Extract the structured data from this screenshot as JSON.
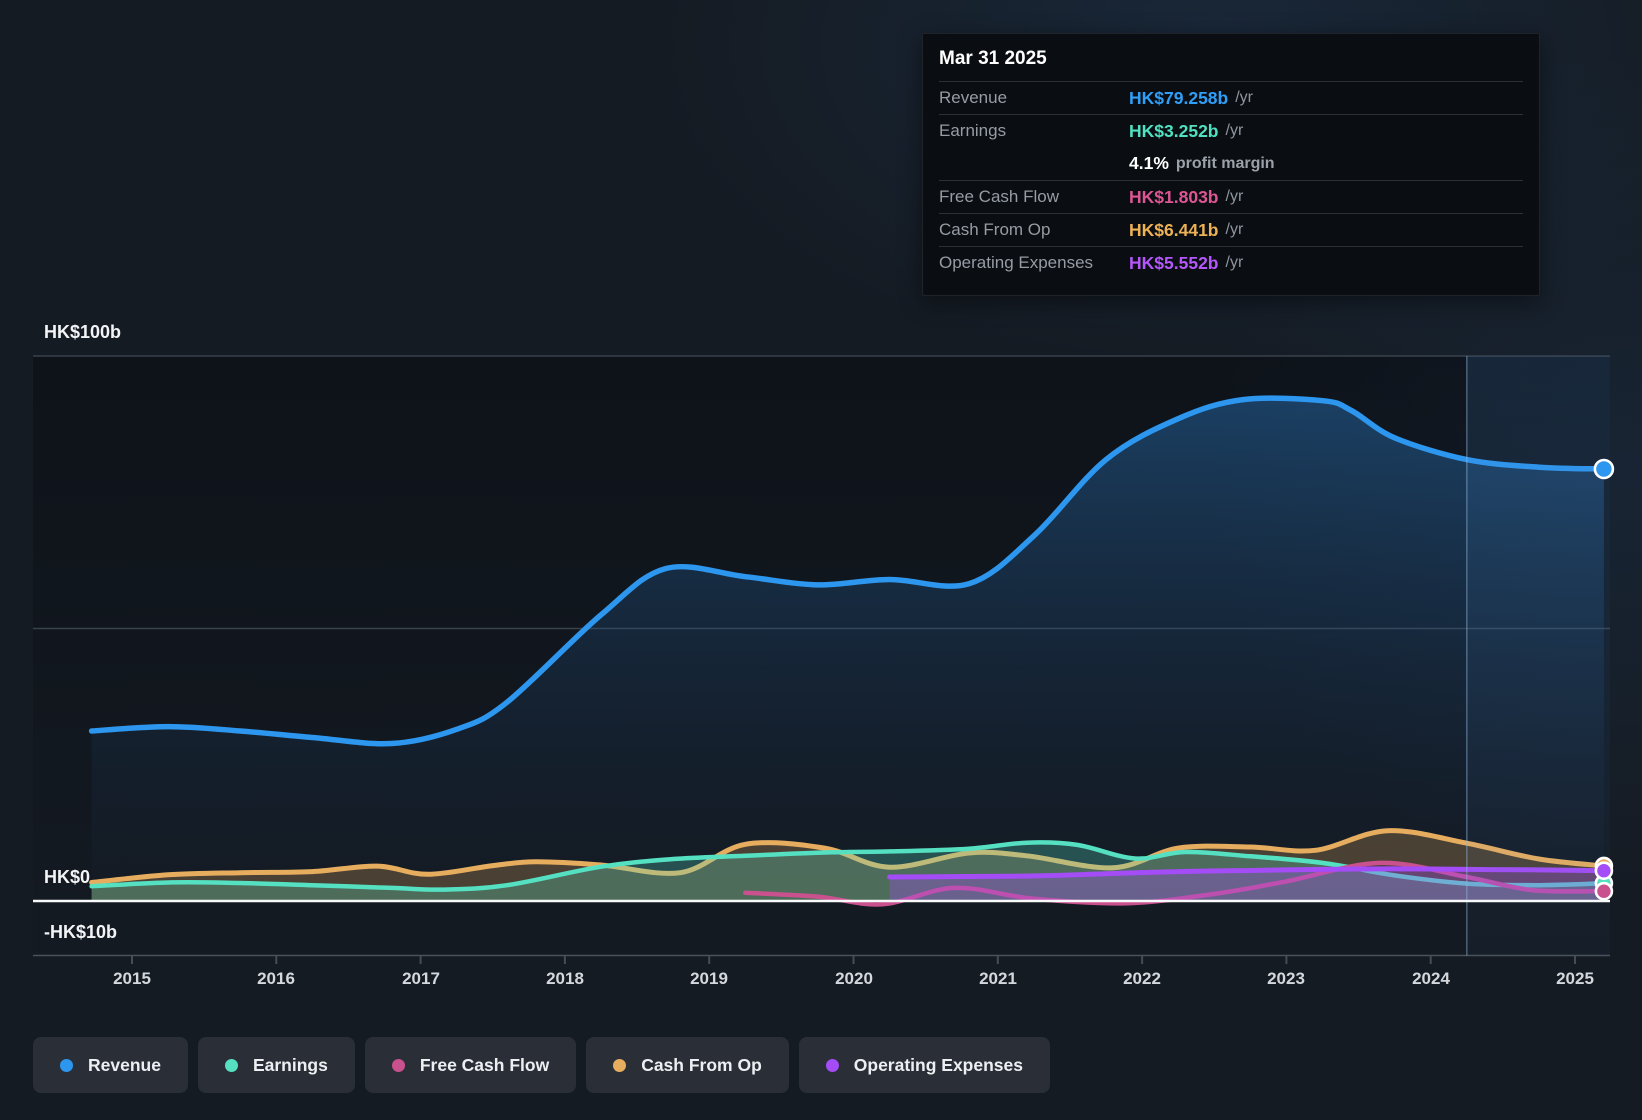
{
  "tooltip": {
    "date": "Mar 31 2025",
    "rows": [
      {
        "key": "revenue",
        "label": "Revenue",
        "value": "HK$79.258b",
        "suffix": "/yr",
        "color": "#2f9ff7",
        "divider_above": true,
        "suffix_strong": false
      },
      {
        "key": "earnings",
        "label": "Earnings",
        "value": "HK$3.252b",
        "suffix": "/yr",
        "color": "#50e2c0",
        "divider_above": true,
        "suffix_strong": false
      },
      {
        "key": "profit-margin",
        "label": "",
        "value": "4.1%",
        "suffix": "profit margin",
        "color": "#ffffff",
        "divider_above": false,
        "suffix_strong": true
      },
      {
        "key": "free-cash-flow",
        "label": "Free Cash Flow",
        "value": "HK$1.803b",
        "suffix": "/yr",
        "color": "#dd5693",
        "divider_above": true,
        "suffix_strong": false
      },
      {
        "key": "cash-from-op",
        "label": "Cash From Op",
        "value": "HK$6.441b",
        "suffix": "/yr",
        "color": "#edb256",
        "divider_above": true,
        "suffix_strong": false
      },
      {
        "key": "operating-expenses",
        "label": "Operating Expenses",
        "value": "HK$5.552b",
        "suffix": "/yr",
        "color": "#b557fa",
        "divider_above": true,
        "suffix_strong": false
      }
    ]
  },
  "y_axis": {
    "labels": [
      {
        "text": "HK$100b",
        "value": 100
      },
      {
        "text": "HK$0",
        "value": 0
      },
      {
        "text": "-HK$10b",
        "value": -10
      }
    ]
  },
  "x_axis": {
    "years": [
      2015,
      2016,
      2017,
      2018,
      2019,
      2020,
      2021,
      2022,
      2023,
      2024,
      2025
    ]
  },
  "legend": [
    {
      "key": "revenue",
      "label": "Revenue",
      "color": "#2d96ee"
    },
    {
      "key": "earnings",
      "label": "Earnings",
      "color": "#55e0c2"
    },
    {
      "key": "free-cash-flow",
      "label": "Free Cash Flow",
      "color": "#c9518e"
    },
    {
      "key": "cash-from-op",
      "label": "Cash From Op",
      "color": "#e7ad5f"
    },
    {
      "key": "operating-expenses",
      "label": "Operating Expenses",
      "color": "#a44cf5"
    }
  ],
  "chart_data": {
    "type": "area",
    "title": "",
    "x_unit": "fiscal year (fractional years = quarters)",
    "ylabel": "HK$ billions per year",
    "ylim": [
      -10,
      100
    ],
    "x_range": [
      2014.72,
      2025.2
    ],
    "gridlines": [
      100,
      50,
      0,
      -10
    ],
    "now_marker": 2024.25,
    "series": [
      {
        "name": "Revenue",
        "key": "revenue",
        "color": "#2d96ee",
        "width": 5.5,
        "area": true,
        "gradient": true,
        "marker_r": 9,
        "points": [
          [
            2014.72,
            31.2
          ],
          [
            2015.25,
            32.0
          ],
          [
            2015.75,
            31.2
          ],
          [
            2016.25,
            30.0
          ],
          [
            2016.8,
            28.9
          ],
          [
            2017.25,
            31.5
          ],
          [
            2017.6,
            36.5
          ],
          [
            2018.25,
            52.5
          ],
          [
            2018.7,
            61.0
          ],
          [
            2019.25,
            59.5
          ],
          [
            2019.75,
            58.0
          ],
          [
            2020.25,
            59.0
          ],
          [
            2020.8,
            58.2
          ],
          [
            2021.25,
            67.0
          ],
          [
            2021.75,
            81.0
          ],
          [
            2022.25,
            88.5
          ],
          [
            2022.7,
            92.0
          ],
          [
            2023.25,
            91.8
          ],
          [
            2023.45,
            90.0
          ],
          [
            2023.75,
            85.0
          ],
          [
            2024.25,
            81.0
          ],
          [
            2024.75,
            79.6
          ],
          [
            2025.2,
            79.258
          ]
        ]
      },
      {
        "name": "Cash From Op",
        "key": "cash-from-op",
        "color": "#e7ad5f",
        "width": 5,
        "area": true,
        "fill": "rgba(230,173,95,0.26)",
        "marker_r": 8,
        "points": [
          [
            2014.72,
            3.4
          ],
          [
            2015.25,
            4.8
          ],
          [
            2015.75,
            5.2
          ],
          [
            2016.25,
            5.4
          ],
          [
            2016.7,
            6.4
          ],
          [
            2017.05,
            4.9
          ],
          [
            2017.5,
            6.5
          ],
          [
            2017.8,
            7.2
          ],
          [
            2018.25,
            6.6
          ],
          [
            2018.8,
            5.2
          ],
          [
            2019.25,
            10.4
          ],
          [
            2019.8,
            9.7
          ],
          [
            2020.25,
            6.2
          ],
          [
            2020.8,
            8.8
          ],
          [
            2021.2,
            8.3
          ],
          [
            2021.8,
            6.1
          ],
          [
            2022.25,
            9.7
          ],
          [
            2022.75,
            9.9
          ],
          [
            2023.2,
            9.3
          ],
          [
            2023.7,
            12.9
          ],
          [
            2024.25,
            10.6
          ],
          [
            2024.75,
            7.7
          ],
          [
            2025.2,
            6.441
          ]
        ]
      },
      {
        "name": "Earnings",
        "key": "earnings",
        "color": "#55e0c2",
        "width": 4.5,
        "area": true,
        "fill": "rgba(85,224,194,0.28)",
        "marker_r": 8,
        "points": [
          [
            2014.72,
            2.7
          ],
          [
            2015.25,
            3.4
          ],
          [
            2015.75,
            3.3
          ],
          [
            2016.25,
            2.9
          ],
          [
            2016.8,
            2.4
          ],
          [
            2017.15,
            2.1
          ],
          [
            2017.6,
            2.9
          ],
          [
            2018.25,
            6.3
          ],
          [
            2018.75,
            7.7
          ],
          [
            2019.25,
            8.3
          ],
          [
            2019.8,
            8.9
          ],
          [
            2020.25,
            9.1
          ],
          [
            2020.8,
            9.6
          ],
          [
            2021.2,
            10.7
          ],
          [
            2021.55,
            10.3
          ],
          [
            2021.95,
            7.8
          ],
          [
            2022.3,
            9.0
          ],
          [
            2022.75,
            8.2
          ],
          [
            2023.25,
            7.0
          ],
          [
            2023.75,
            4.7
          ],
          [
            2024.25,
            3.2
          ],
          [
            2024.75,
            2.9
          ],
          [
            2025.2,
            3.252
          ]
        ]
      },
      {
        "name": "Free Cash Flow",
        "key": "free-cash-flow",
        "color": "#c9518e",
        "width": 4.5,
        "area": false,
        "marker_r": 8,
        "points": [
          [
            2019.25,
            1.5
          ],
          [
            2019.75,
            0.8
          ],
          [
            2020.2,
            -0.6
          ],
          [
            2020.7,
            2.4
          ],
          [
            2021.25,
            0.4
          ],
          [
            2021.9,
            -0.4
          ],
          [
            2022.5,
            1.3
          ],
          [
            2023.0,
            3.6
          ],
          [
            2023.65,
            7.0
          ],
          [
            2024.25,
            4.4
          ],
          [
            2024.7,
            2.0
          ],
          [
            2025.2,
            1.803
          ]
        ]
      },
      {
        "name": "Operating Expenses",
        "key": "operating-expenses",
        "color": "#a44cf5",
        "width": 5,
        "area": true,
        "fill": "rgba(164,76,245,0.33)",
        "marker_r": 8,
        "points": [
          [
            2020.25,
            4.4
          ],
          [
            2020.75,
            4.5
          ],
          [
            2021.25,
            4.6
          ],
          [
            2021.75,
            5.0
          ],
          [
            2022.25,
            5.4
          ],
          [
            2022.75,
            5.6
          ],
          [
            2023.25,
            5.8
          ],
          [
            2023.75,
            5.9
          ],
          [
            2024.25,
            5.8
          ],
          [
            2024.75,
            5.7
          ],
          [
            2025.2,
            5.552
          ]
        ]
      }
    ]
  }
}
